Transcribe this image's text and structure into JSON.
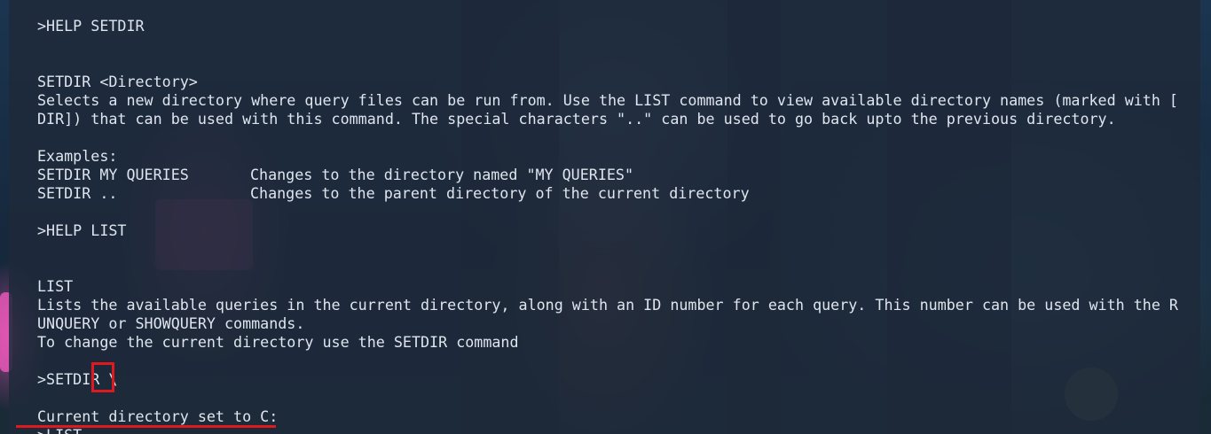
{
  "terminal": {
    "lines": [
      {
        "type": "command",
        "text": ">HELP SETDIR"
      },
      {
        "type": "blank"
      },
      {
        "type": "blank"
      },
      {
        "type": "text",
        "text": "SETDIR <Directory>"
      },
      {
        "type": "text",
        "text": "Selects a new directory where query files can be run from. Use the LIST command to view available directory names (marked with ["
      },
      {
        "type": "text",
        "text": "DIR]) that can be used with this command. The special characters \"..\" can be used to go back upto the previous directory."
      },
      {
        "type": "blank"
      },
      {
        "type": "text",
        "text": "Examples:"
      },
      {
        "type": "example",
        "cmd": "SETDIR MY QUERIES",
        "desc": "Changes to the directory named \"MY QUERIES\""
      },
      {
        "type": "example",
        "cmd": "SETDIR ..",
        "desc": "Changes to the parent directory of the current directory"
      },
      {
        "type": "blank"
      },
      {
        "type": "command",
        "text": ">HELP LIST"
      },
      {
        "type": "blank"
      },
      {
        "type": "blank"
      },
      {
        "type": "text",
        "text": "LIST"
      },
      {
        "type": "text",
        "text": "Lists the available queries in the current directory, along with an ID number for each query. This number can be used with the R"
      },
      {
        "type": "text",
        "text": "UNQUERY or SHOWQUERY commands."
      },
      {
        "type": "text",
        "text": "To change the current directory use the SETDIR command"
      },
      {
        "type": "blank"
      },
      {
        "type": "command",
        "text": ">SETDIR \\"
      },
      {
        "type": "blank"
      },
      {
        "type": "output",
        "text": "Current directory set to C:"
      },
      {
        "type": "command",
        "text": ">LIST"
      }
    ]
  },
  "colors": {
    "terminal_text": "#dfe5ee",
    "terminal_bg": "rgba(30,42,58,0.86)",
    "highlight": "#e0191f"
  }
}
